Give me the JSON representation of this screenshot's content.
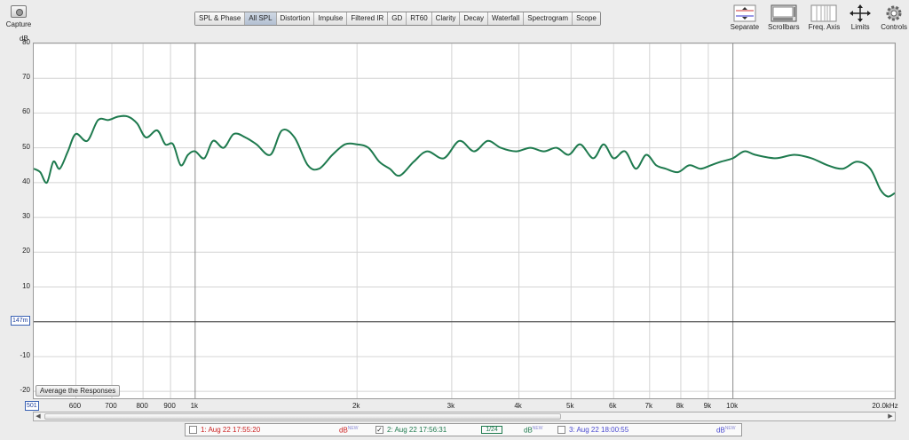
{
  "toolbar": {
    "capture_label": "Capture",
    "tabs": [
      "SPL & Phase",
      "All SPL",
      "Distortion",
      "Impulse",
      "Filtered IR",
      "GD",
      "RT60",
      "Clarity",
      "Decay",
      "Waterfall",
      "Spectrogram",
      "Scope"
    ],
    "active_tab": "All SPL",
    "right_tools": [
      {
        "label": "Separate",
        "icon": "separate-icon"
      },
      {
        "label": "Scrollbars",
        "icon": "scrollbars-icon"
      },
      {
        "label": "Freq. Axis",
        "icon": "freq-axis-icon"
      },
      {
        "label": "Limits",
        "icon": "limits-icon"
      },
      {
        "label": "Controls",
        "icon": "gear-icon"
      }
    ]
  },
  "chart_controls": {
    "average_button": "Average the Responses",
    "y_marker": "147m",
    "x_min_value": "501"
  },
  "measurements": [
    {
      "label": "1: Aug 22 17:55:20",
      "checked": false,
      "color": "#cc2222",
      "unit": "dB",
      "badge": "NEW"
    },
    {
      "label": "2: Aug 22 17:56:31",
      "checked": true,
      "color": "#1e7a4e",
      "unit": "dB",
      "badge": "NEW",
      "smoothing": "1/24"
    },
    {
      "label": "3: Aug 22 18:00:55",
      "checked": false,
      "color": "#4a4ad0",
      "unit": "dB",
      "badge": "NEW"
    }
  ],
  "chart_data": {
    "type": "line",
    "ylabel": "dB",
    "xlabel": "",
    "xscale": "log",
    "xlim": [
      501,
      20000
    ],
    "ylim": [
      -22,
      80
    ],
    "yticks": [
      80,
      70,
      60,
      50,
      40,
      30,
      20,
      10,
      0,
      -10,
      -20
    ],
    "xtick_labels": [
      {
        "v": 600,
        "t": "600"
      },
      {
        "v": 700,
        "t": "700"
      },
      {
        "v": 800,
        "t": "800"
      },
      {
        "v": 900,
        "t": "900"
      },
      {
        "v": 1000,
        "t": "1k"
      },
      {
        "v": 2000,
        "t": "2k"
      },
      {
        "v": 3000,
        "t": "3k"
      },
      {
        "v": 4000,
        "t": "4k"
      },
      {
        "v": 5000,
        "t": "5k"
      },
      {
        "v": 6000,
        "t": "6k"
      },
      {
        "v": 7000,
        "t": "7k"
      },
      {
        "v": 8000,
        "t": "8k"
      },
      {
        "v": 9000,
        "t": "9k"
      },
      {
        "v": 10000,
        "t": "10k"
      },
      {
        "v": 20000,
        "t": "20.0kHz"
      }
    ],
    "horizontal_line_at": 0,
    "grid": true,
    "series": [
      {
        "name": "2: Aug 22 17:56:31",
        "color": "#1e7a4e",
        "x": [
          501,
          515,
          530,
          545,
          560,
          580,
          600,
          630,
          660,
          690,
          720,
          750,
          780,
          810,
          850,
          880,
          910,
          940,
          970,
          1000,
          1040,
          1080,
          1130,
          1180,
          1240,
          1300,
          1380,
          1450,
          1530,
          1620,
          1700,
          1800,
          1900,
          2000,
          2100,
          2200,
          2300,
          2400,
          2550,
          2700,
          2900,
          3100,
          3300,
          3500,
          3700,
          3950,
          4200,
          4450,
          4700,
          4950,
          5200,
          5500,
          5750,
          6000,
          6300,
          6600,
          6900,
          7200,
          7500,
          7900,
          8300,
          8700,
          9100,
          9500,
          10000,
          10500,
          11000,
          12000,
          13000,
          14000,
          15000,
          16000,
          17000,
          18000,
          18800,
          19400,
          20000
        ],
        "y": [
          44,
          43,
          40,
          46,
          44,
          49,
          54,
          52,
          58,
          58,
          59,
          59,
          57,
          53,
          55,
          51,
          51,
          45,
          48,
          49,
          47,
          52,
          50,
          54,
          53,
          51,
          48,
          55,
          53,
          45,
          44,
          48,
          51,
          51,
          50,
          46,
          44,
          42,
          46,
          49,
          47,
          52,
          49,
          52,
          50,
          49,
          50,
          49,
          50,
          48,
          51,
          47,
          51,
          47,
          49,
          44,
          48,
          45,
          44,
          43,
          45,
          44,
          45,
          46,
          47,
          49,
          48,
          47,
          48,
          47,
          45,
          44,
          46,
          44,
          38,
          36,
          37
        ]
      }
    ]
  }
}
